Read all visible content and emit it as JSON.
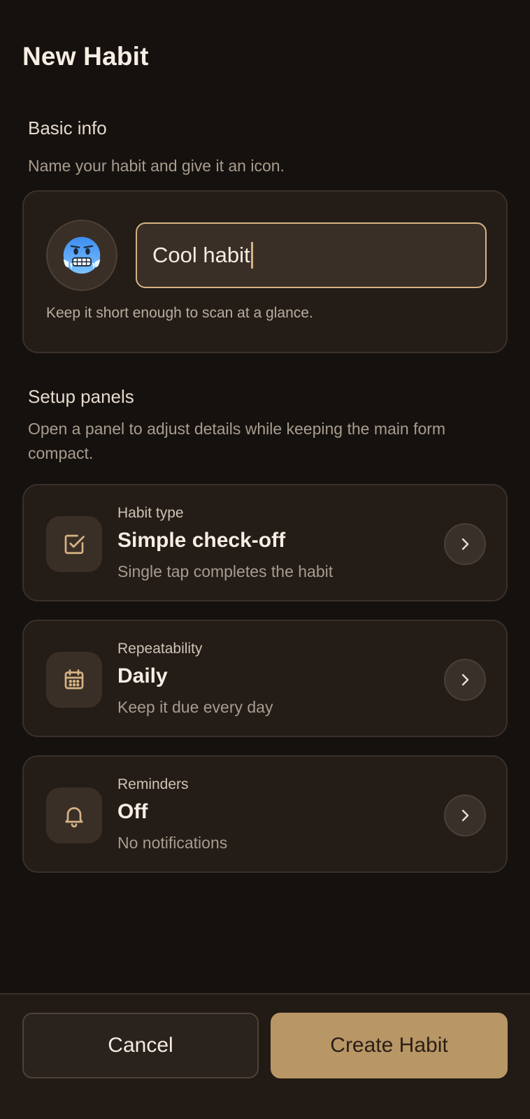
{
  "page": {
    "title": "New Habit"
  },
  "basic_info": {
    "title": "Basic info",
    "subtitle": "Name your habit and give it an icon.",
    "emoji": "🥶",
    "emoji_icon": "cold-face-emoji",
    "name_value": "Cool habit",
    "hint": "Keep it short enough to scan at a glance."
  },
  "setup": {
    "title": "Setup panels",
    "subtitle": "Open a panel to adjust details while keeping the main form compact.",
    "panels": [
      {
        "kicker": "Habit type",
        "value": "Simple check-off",
        "desc": "Single tap completes the habit",
        "icon": "checkbox-icon"
      },
      {
        "kicker": "Repeatability",
        "value": "Daily",
        "desc": "Keep it due every day",
        "icon": "calendar-icon"
      },
      {
        "kicker": "Reminders",
        "value": "Off",
        "desc": "No notifications",
        "icon": "bell-icon"
      }
    ]
  },
  "footer": {
    "cancel_label": "Cancel",
    "create_label": "Create Habit"
  },
  "colors": {
    "background": "#15110e",
    "card": "#231c17",
    "accent": "#d6b384",
    "primary_button": "#b89665"
  }
}
